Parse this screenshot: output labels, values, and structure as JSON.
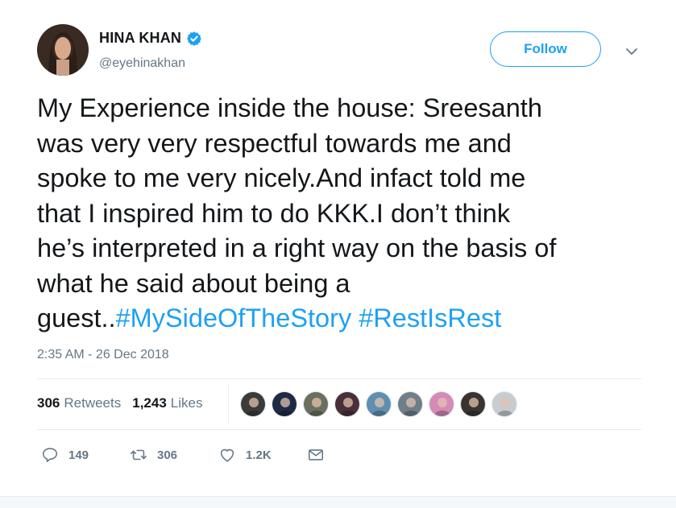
{
  "author": {
    "name": "HINA KHAN",
    "handle": "@eyehinakhan",
    "verified": true,
    "avatar_icon": "profile-photo-icon"
  },
  "follow_label": "Follow",
  "tweet": {
    "text_segments": [
      {
        "text": "My Experience inside the house: Sreesanth\nwas very very respectful towards me and\nspoke to me very nicely.And infact told me\nthat I inspired him to do KKK.I don’t think\nhe’s interpreted in a right way on the basis of\nwhat he said about being a\nguest..",
        "hashtag": false
      },
      {
        "text": "#MySideOfTheStory",
        "hashtag": true
      },
      {
        "text": " ",
        "hashtag": false
      },
      {
        "text": "#RestIsRest",
        "hashtag": true
      }
    ],
    "timestamp": "2:35 AM - 26 Dec 2018"
  },
  "stats": {
    "retweets_count": "306",
    "retweets_label": "Retweets",
    "likes_count": "1,243",
    "likes_label": "Likes"
  },
  "likers": [
    {
      "icon": "liker-avatar-icon",
      "color": "#3b3b3b"
    },
    {
      "icon": "liker-avatar-icon",
      "color": "#1f2a44"
    },
    {
      "icon": "liker-avatar-icon",
      "color": "#6b6f5e"
    },
    {
      "icon": "liker-avatar-icon",
      "color": "#4a2f3a"
    },
    {
      "icon": "liker-avatar-icon",
      "color": "#5f8fb0"
    },
    {
      "icon": "liker-avatar-icon",
      "color": "#6f7e88"
    },
    {
      "icon": "liker-avatar-icon",
      "color": "#d58ab8"
    },
    {
      "icon": "liker-avatar-icon",
      "color": "#3a3430"
    },
    {
      "icon": "liker-avatar-icon",
      "color": "#c7ccd1"
    }
  ],
  "actions": {
    "reply_count": "149",
    "retweet_count": "306",
    "like_count": "1.2K"
  },
  "colors": {
    "accent": "#1da1f2",
    "text": "#14171a",
    "muted": "#657786",
    "divider": "#e6ecf0"
  }
}
